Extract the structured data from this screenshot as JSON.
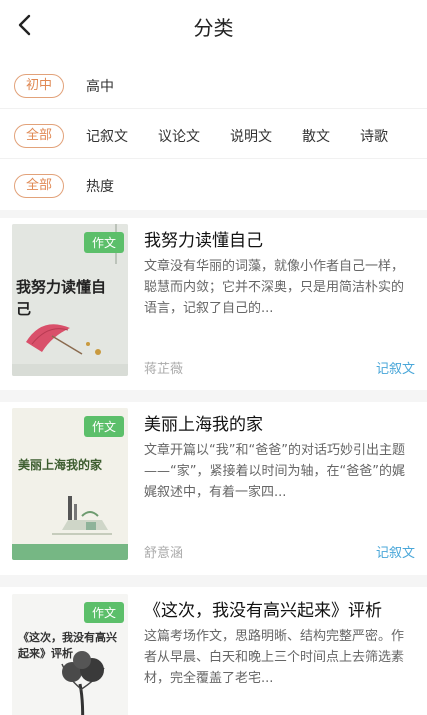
{
  "header": {
    "title": "分类"
  },
  "filters": {
    "grade": {
      "selected": "初中",
      "options": [
        "高中"
      ]
    },
    "genre": {
      "selected": "全部",
      "options": [
        "记叙文",
        "议论文",
        "说明文",
        "散文",
        "诗歌"
      ]
    },
    "sort": {
      "selected": "全部",
      "options": [
        "热度"
      ]
    }
  },
  "articles": [
    {
      "tag": "作文",
      "title": "我努力读懂自己",
      "description": "文章没有华丽的词藻，就像小作者自己一样，聪慧而内敛；它并不深奥，只是用简洁朴实的语言，记叙了自己的...",
      "author": "蒋芷薇",
      "category": "记叙文",
      "cover_text": "我努力读懂自己"
    },
    {
      "tag": "作文",
      "title": "美丽上海我的家",
      "description": "文章开篇以“我”和“爸爸”的对话巧妙引出主题——“家”，紧接着以时间为轴，在“爸爸”的娓娓叙述中，有着一家四...",
      "author": "舒意涵",
      "category": "记叙文",
      "cover_text": "美丽上海我的家"
    },
    {
      "tag": "作文",
      "title": "《这次，我没有高兴起来》评析",
      "description": "这篇考场作文，思路明晰、结构完整严密。作者从早晨、白天和晚上三个时间点上去筛选素材，完全覆盖了老宅...",
      "cover_text": "《这次，我没有高兴起来》评析"
    }
  ],
  "colors": {
    "accent": "#e08954",
    "tag_green": "#5cbf6a",
    "category_blue": "#4aa7d9"
  },
  "icons": {
    "back": "chevron-left-icon"
  }
}
